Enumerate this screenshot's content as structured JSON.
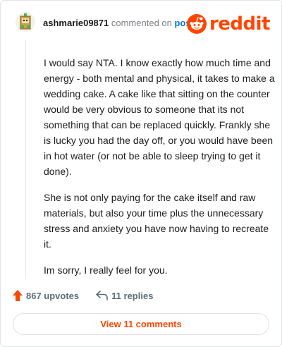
{
  "comment": {
    "username": "ashmarie09871",
    "commented_on_text": "commented on",
    "post_link": "post",
    "paragraphs": [
      "I would say NTA. I know exactly how much time and energy - both mental and physical, it takes to make a wedding cake. A cake like that sitting on the counter would be very obvious to someone that its not something that can be replaced quickly. Frankly she is lucky you had the day off, or you would have been in hot water (or not be able to sleep trying to get it done).",
      "She is not only paying for the cake itself and raw materials, but also your time plus the unnecessary stress and anxiety you have now having to recreate it.",
      "Im sorry, I really feel for you."
    ]
  },
  "brand": {
    "wordmark": "reddit",
    "color": "#ff4500"
  },
  "actions": {
    "upvotes_label": "867 upvotes",
    "replies_label": "11 replies",
    "view_comments_label": "View 11 comments"
  },
  "icons": {
    "avatar": "box-character-avatar",
    "logo": "reddit-snoo-icon",
    "upvote": "upvote-arrow-icon",
    "reply": "reply-arrow-icon"
  }
}
